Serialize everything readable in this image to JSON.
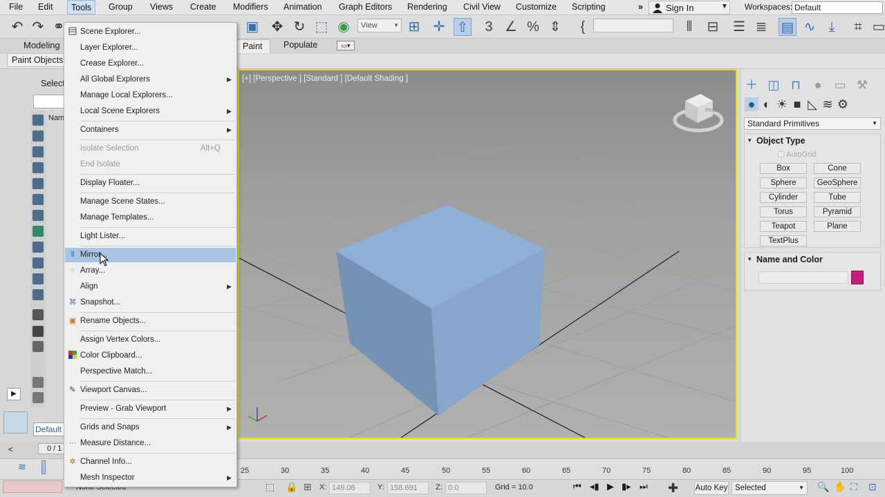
{
  "menubar": {
    "items": [
      "File",
      "Edit",
      "Tools",
      "Group",
      "Views",
      "Create",
      "Modifiers",
      "Animation",
      "Graph Editors",
      "Rendering",
      "Civil View",
      "Customize",
      "Scripting"
    ],
    "more": "»",
    "signin": "Sign In",
    "workspaces_label": "Workspaces:",
    "workspaces_value": "Default"
  },
  "toolbar": {
    "view_dropdown": "View"
  },
  "ribbon": {
    "modeling": "Modeling",
    "paint": "Paint",
    "populate": "Populate",
    "paint_objects": "Paint Objects"
  },
  "scene_explorer": {
    "select": "Select",
    "name": "Nam",
    "default": "Default"
  },
  "viewport": {
    "label": "[+] [Perspective ] [Standard ] [Default Shading ]",
    "cube_label": "FRONT"
  },
  "tools_menu": {
    "items": [
      {
        "label": "Scene Explorer...",
        "icon": "scene-explorer-icon"
      },
      {
        "label": "Layer Explorer..."
      },
      {
        "label": "Crease Explorer..."
      },
      {
        "label": "All Global Explorers",
        "submenu": true
      },
      {
        "label": "Manage Local Explorers..."
      },
      {
        "label": "Local Scene Explorers",
        "submenu": true
      },
      {
        "label": "Containers",
        "submenu": true
      },
      {
        "label": "Isolate Selection",
        "shortcut": "Alt+Q",
        "disabled": true
      },
      {
        "label": "End Isolate",
        "disabled": true
      },
      {
        "label": "Display Floater..."
      },
      {
        "label": "Manage Scene States..."
      },
      {
        "label": "Manage Templates..."
      },
      {
        "label": "Light Lister..."
      },
      {
        "label": "Mirror...",
        "icon": "mirror-icon",
        "highlighted": true
      },
      {
        "label": "Array...",
        "icon": "array-icon"
      },
      {
        "label": "Align",
        "submenu": true
      },
      {
        "label": "Snapshot...",
        "icon": "snapshot-icon"
      },
      {
        "label": "Rename Objects...",
        "icon": "rename-objects-icon"
      },
      {
        "label": "Assign Vertex Colors..."
      },
      {
        "label": "Color Clipboard...",
        "icon": "color-clipboard-icon"
      },
      {
        "label": "Perspective Match..."
      },
      {
        "label": "Viewport Canvas...",
        "icon": "viewport-canvas-icon"
      },
      {
        "label": "Preview - Grab Viewport",
        "submenu": true
      },
      {
        "label": "Grids and Snaps",
        "submenu": true
      },
      {
        "label": "Measure Distance...",
        "icon": "measure-distance-icon"
      },
      {
        "label": "Channel Info...",
        "icon": "channel-info-icon"
      },
      {
        "label": "Mesh Inspector",
        "submenu": true
      }
    ]
  },
  "command_panel": {
    "dropdown": "Standard Primitives",
    "object_type_title": "Object Type",
    "autogrid": "AutoGrid",
    "primitives": [
      "Box",
      "Cone",
      "Sphere",
      "GeoSphere",
      "Cylinder",
      "Tube",
      "Torus",
      "Pyramid",
      "Teapot",
      "Plane",
      "TextPlus"
    ],
    "name_color_title": "Name and Color",
    "object_color": "#c81e82"
  },
  "timeline": {
    "frame_counter": "0 / 1",
    "ticks": [
      "25",
      "30",
      "35",
      "40",
      "45",
      "50",
      "55",
      "60",
      "65",
      "70",
      "75",
      "80",
      "85",
      "90",
      "95",
      "100"
    ]
  },
  "statusbar": {
    "selection": "None Selected",
    "x_label": "X:",
    "x_value": "149.06",
    "y_label": "Y:",
    "y_value": "158.691",
    "z_label": "Z:",
    "z_value": "0.0",
    "grid": "Grid = 10.0",
    "autokey": "Auto Key",
    "selected": "Selected"
  }
}
